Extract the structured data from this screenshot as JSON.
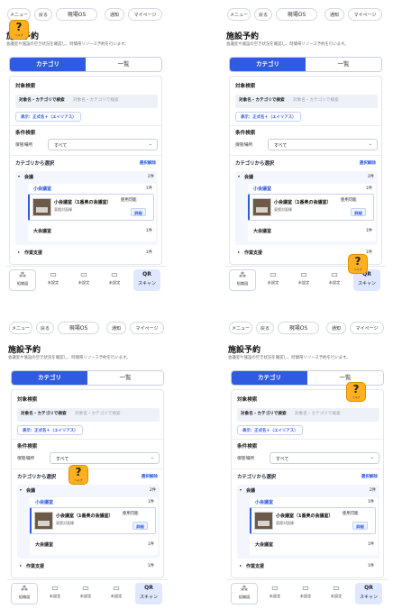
{
  "topbar": {
    "menu": "メニュー",
    "back": "戻る",
    "genba_os": "現場OS",
    "notice": "通知",
    "mypage": "マイページ"
  },
  "page": {
    "title": "施設予約",
    "subtitle": "会議室や施設の空き状況を確認し、時間帯リソース予約を行います。"
  },
  "tabs": {
    "category": "カテゴリ",
    "list": "一覧"
  },
  "search": {
    "section": "対象検索",
    "tag": "対象名・カテゴリで検索",
    "placeholder": "対象名・カテゴリで検索",
    "display_pill": "表示：正式名＋（エイリアス）"
  },
  "filter": {
    "section": "条件検索",
    "storage_label": "保管場所",
    "storage_value": "すべて"
  },
  "category_select": {
    "label": "カテゴリから選択",
    "clear": "選択解除"
  },
  "tree": {
    "kaigi": {
      "label": "会議",
      "count": "2件"
    },
    "small_room": {
      "label": "小会議室",
      "count": "1件"
    },
    "item": {
      "name": "小会議室（1番奥の会議室）",
      "location": "東館対面棟",
      "status": "使用可能",
      "detail": "詳細"
    },
    "large_room": {
      "label": "大会議室",
      "count": "1件"
    },
    "work_support": {
      "label": "作業支援",
      "count": "1件"
    }
  },
  "bottom_nav": {
    "home": "組織図",
    "unset1": "未設定",
    "unset2": "未設定",
    "unset3": "未設定",
    "qr": "QR",
    "scan": "スキャン"
  },
  "help": {
    "label": "ヘルプ"
  },
  "colors": {
    "accent": "#2f5be0",
    "help": "#ffb020"
  }
}
